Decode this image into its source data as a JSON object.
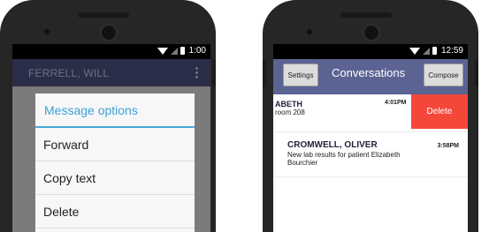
{
  "left_phone": {
    "status_bar": {
      "time": "1:00"
    },
    "app_bar": {
      "title": "FERRELL, WILL"
    },
    "dialog": {
      "title": "Message options",
      "options": [
        "Forward",
        "Copy text",
        "Delete"
      ]
    }
  },
  "right_phone": {
    "status_bar": {
      "time": "12:59"
    },
    "app_bar": {
      "settings_label": "Settings",
      "title": "Conversations",
      "compose_label": "Compose"
    },
    "conversations": [
      {
        "name": "ABETH",
        "preview": "room 208",
        "time": "4:01PM",
        "swipe_action": "Delete"
      },
      {
        "name": "CROMWELL, OLIVER",
        "preview": "New lab results for patient Elizabeth Bourchier",
        "time": "3:58PM"
      }
    ]
  },
  "colors": {
    "phone_body": "#262626",
    "left_app_bar": "#2a2e48",
    "right_app_bar": "#5b6393",
    "dialog_accent": "#3ea0d4",
    "delete_red": "#f4473a"
  }
}
